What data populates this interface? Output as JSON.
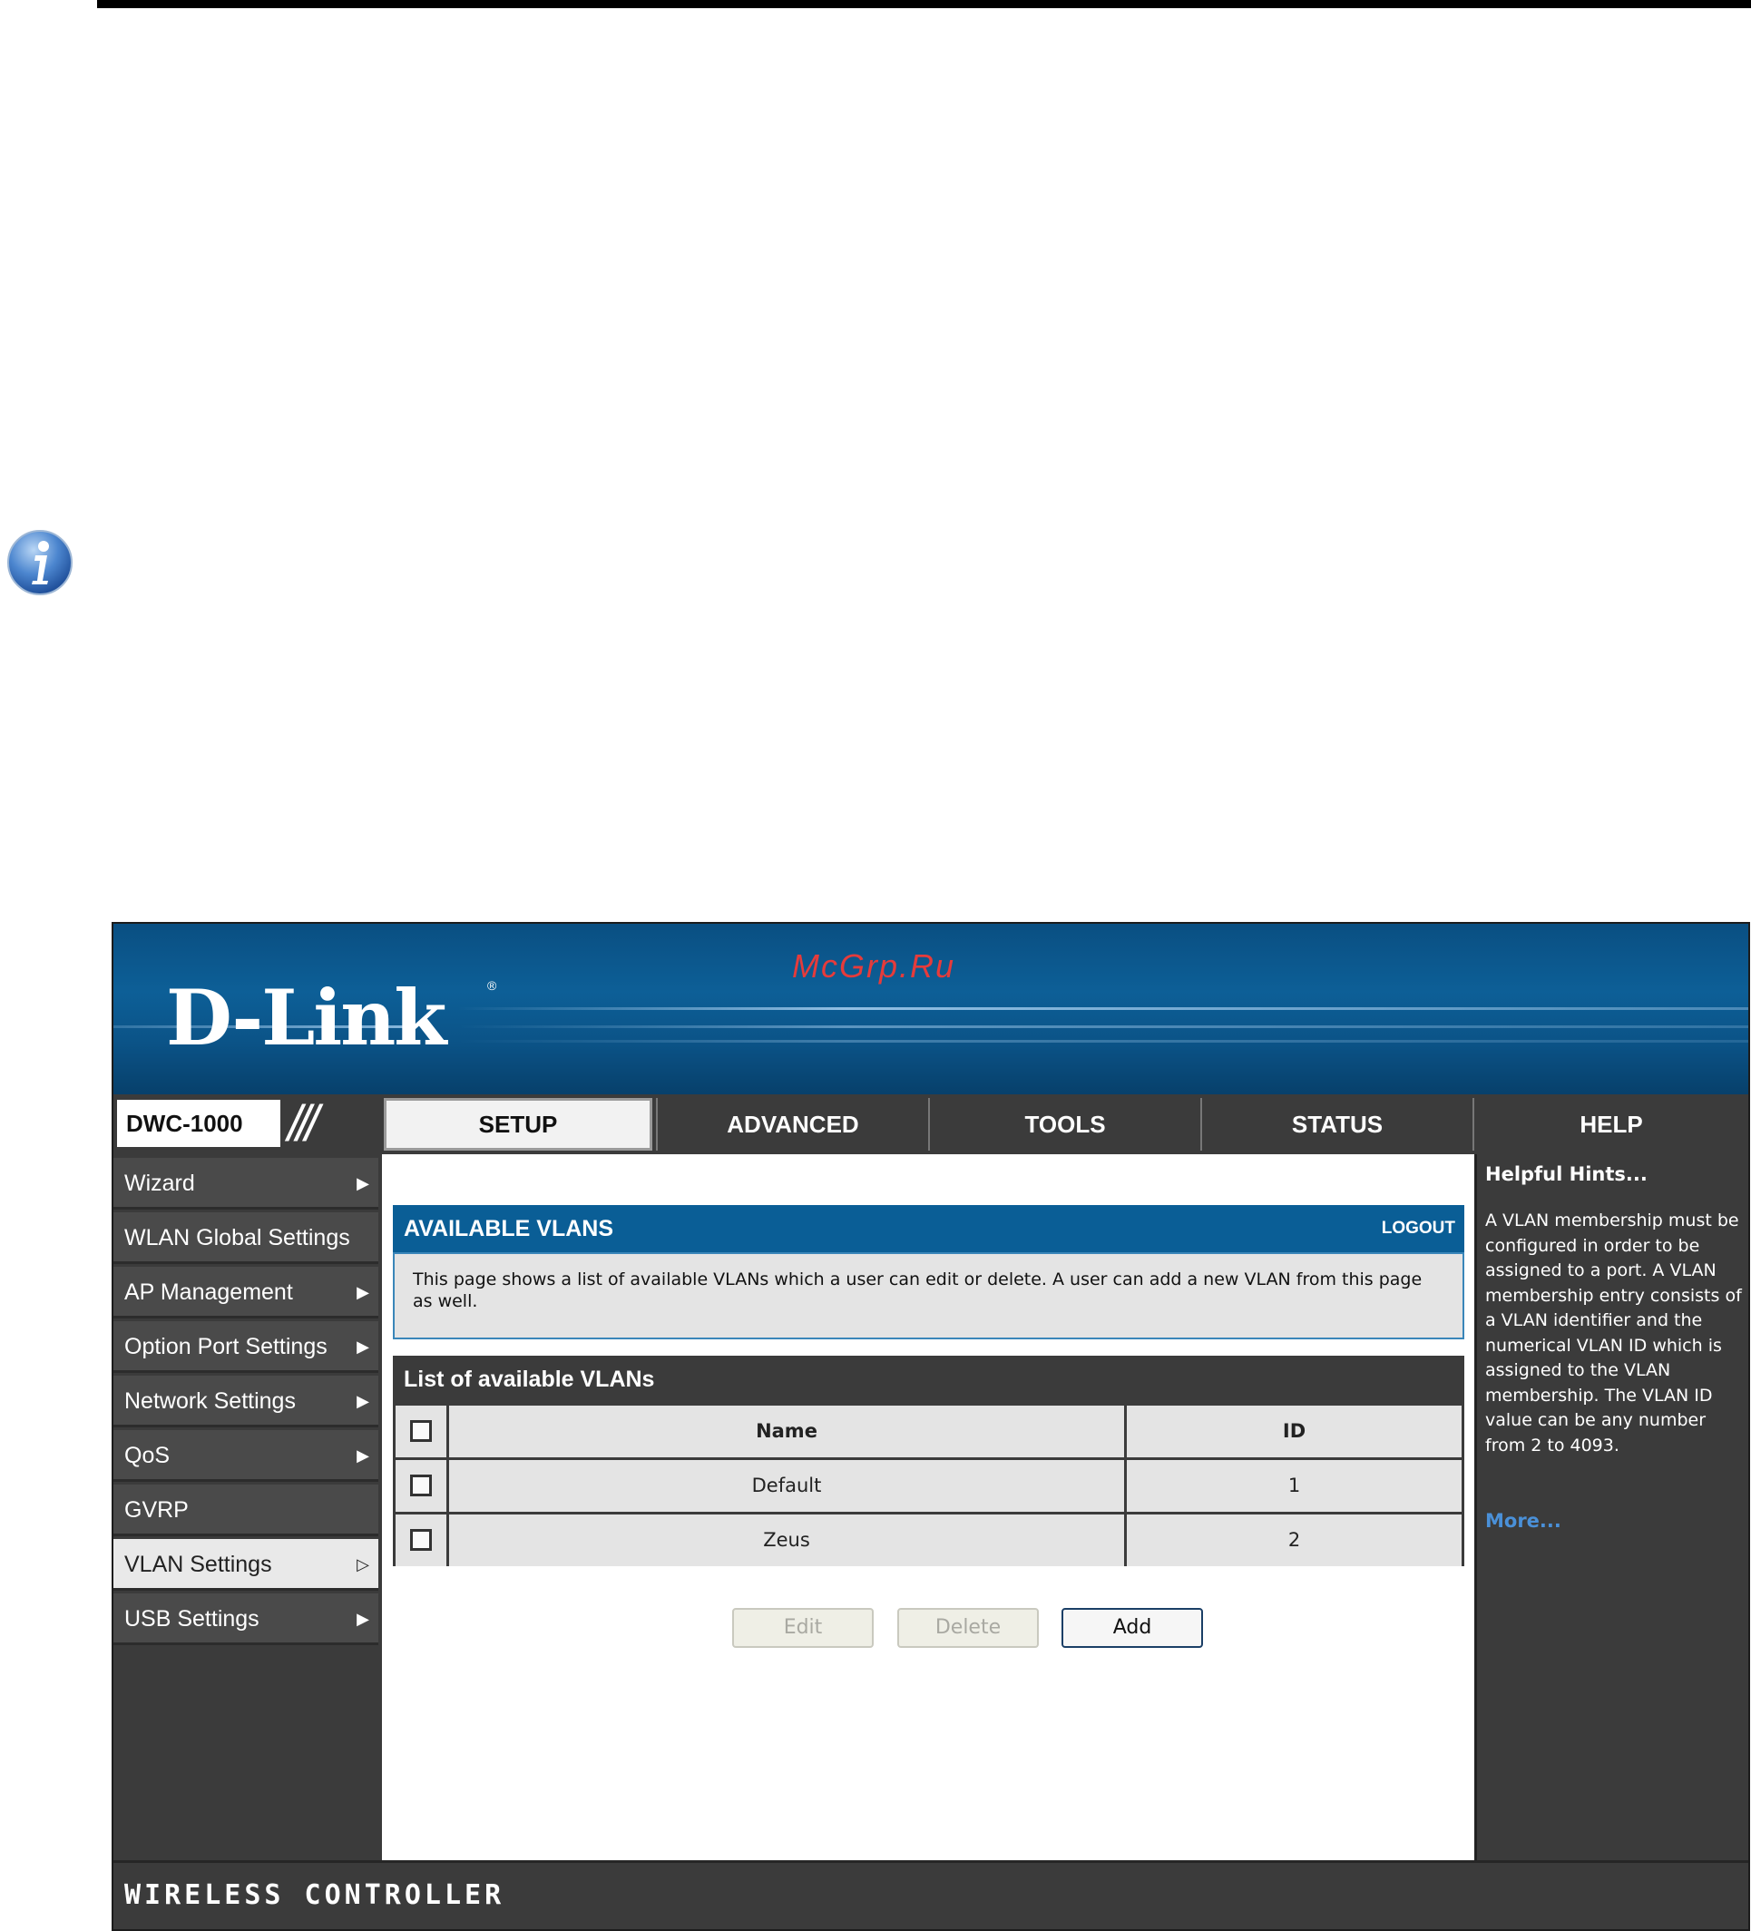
{
  "brand": {
    "logo": "D-Link",
    "registered_mark": "®",
    "watermark": "McGrp.Ru"
  },
  "model": "DWC-1000",
  "tabs": [
    {
      "label": "SETUP",
      "active": true
    },
    {
      "label": "ADVANCED",
      "active": false
    },
    {
      "label": "TOOLS",
      "active": false
    },
    {
      "label": "STATUS",
      "active": false
    },
    {
      "label": "HELP",
      "active": false
    }
  ],
  "sidebar": {
    "items": [
      {
        "label": "Wizard",
        "arrow": true,
        "active": false
      },
      {
        "label": "WLAN Global Settings",
        "arrow": false,
        "active": false
      },
      {
        "label": "AP Management",
        "arrow": true,
        "active": false
      },
      {
        "label": "Option Port Settings",
        "arrow": true,
        "active": false
      },
      {
        "label": "Network Settings",
        "arrow": true,
        "active": false
      },
      {
        "label": "QoS",
        "arrow": true,
        "active": false
      },
      {
        "label": "GVRP",
        "arrow": false,
        "active": false
      },
      {
        "label": "VLAN Settings",
        "arrow": true,
        "active": true
      },
      {
        "label": "USB Settings",
        "arrow": true,
        "active": false
      }
    ]
  },
  "main": {
    "section_title": "AVAILABLE VLANS",
    "logout_label": "LOGOUT",
    "description": "This page shows a list of available VLANs which a user can edit or delete. A user can add a new VLAN from this page as well.",
    "list_title": "List of available VLANs",
    "table": {
      "headers": [
        "Name",
        "ID"
      ],
      "rows": [
        {
          "name": "Default",
          "id": "1"
        },
        {
          "name": "Zeus",
          "id": "2"
        }
      ]
    },
    "buttons": {
      "edit": "Edit",
      "delete": "Delete",
      "add": "Add"
    }
  },
  "help": {
    "title": "Helpful Hints...",
    "text": "A VLAN membership must be configured in order to be assigned to a port. A VLAN membership entry consists of a VLAN identifier and the numerical VLAN ID which is assigned to the VLAN membership. The VLAN ID value can be any number from 2 to 4093.",
    "more_label": "More..."
  },
  "footer": {
    "text": "WIRELESS CONTROLLER"
  },
  "colors": {
    "banner_blue": "#0d5f97",
    "section_header_blue": "#0a5e96",
    "panel_gray": "#3b3b3b",
    "link_blue": "#4a90d8",
    "watermark_red": "#e63b3b"
  },
  "icons": {
    "note_icon": "info-icon",
    "nav_arrow": "triangle-right-icon",
    "nav_arrow_active": "triangle-right-outline-icon"
  }
}
